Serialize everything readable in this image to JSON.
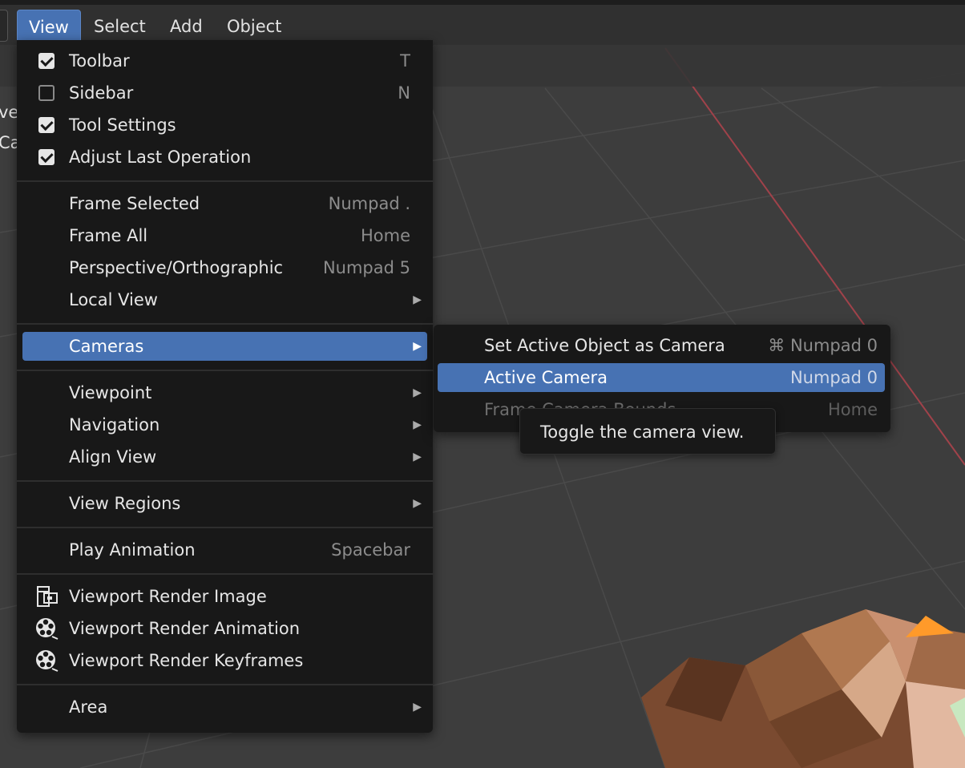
{
  "header": {
    "menus": [
      {
        "label": "View",
        "active": true
      },
      {
        "label": "Select"
      },
      {
        "label": "Add"
      },
      {
        "label": "Object"
      }
    ],
    "left_fragments": [
      "ve",
      "Ca"
    ]
  },
  "view_menu": {
    "items": {
      "toolbar": {
        "label": "Toolbar",
        "shortcut": "T",
        "checked": true
      },
      "sidebar": {
        "label": "Sidebar",
        "shortcut": "N",
        "checked": false
      },
      "tool_settings": {
        "label": "Tool Settings",
        "checked": true
      },
      "adjust_last": {
        "label": "Adjust Last Operation",
        "checked": true
      },
      "frame_selected": {
        "label": "Frame Selected",
        "shortcut": "Numpad ."
      },
      "frame_all": {
        "label": "Frame All",
        "shortcut": "Home"
      },
      "persp_ortho": {
        "label": "Perspective/Orthographic",
        "shortcut": "Numpad 5"
      },
      "local_view": {
        "label": "Local View"
      },
      "cameras": {
        "label": "Cameras"
      },
      "viewpoint": {
        "label": "Viewpoint"
      },
      "navigation": {
        "label": "Navigation"
      },
      "align_view": {
        "label": "Align View"
      },
      "view_regions": {
        "label": "View Regions"
      },
      "play_animation": {
        "label": "Play Animation",
        "shortcut": "Spacebar"
      },
      "render_image": {
        "label": "Viewport Render Image",
        "icon": "render-still-icon"
      },
      "render_animation": {
        "label": "Viewport Render Animation",
        "icon": "render-animation-icon"
      },
      "render_keyframes": {
        "label": "Viewport Render Keyframes",
        "icon": "render-animation-icon"
      },
      "area": {
        "label": "Area"
      }
    }
  },
  "cameras_menu": {
    "items": {
      "set_active": {
        "label": "Set Active Object as Camera",
        "shortcut": "⌘ Numpad 0"
      },
      "active_camera": {
        "label": "Active Camera",
        "shortcut": "Numpad 0"
      },
      "frame_bounds": {
        "label": "Frame Camera Bounds",
        "shortcut": "Home"
      }
    }
  },
  "tooltip": {
    "text": "Toggle the camera view."
  },
  "colors": {
    "accent": "#4772b3",
    "menu_bg": "#181818",
    "viewport_bg": "#3d3d3d",
    "x_axis": "#b3404a"
  }
}
